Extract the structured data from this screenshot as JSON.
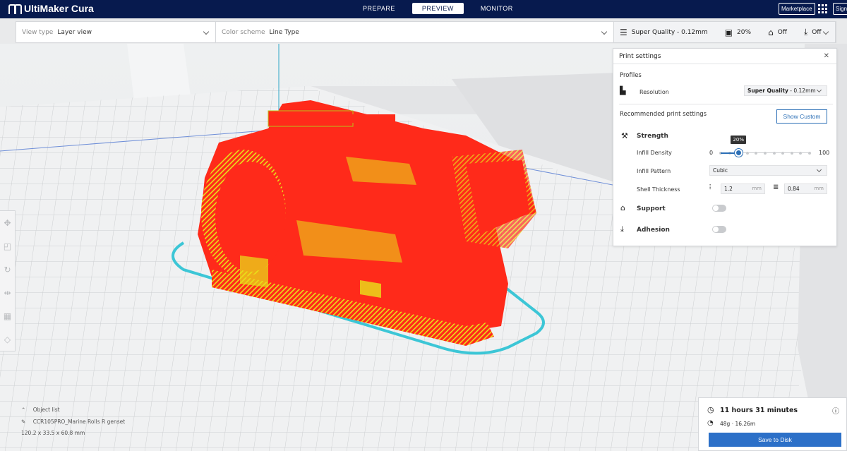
{
  "app": {
    "title": "UltiMaker Cura"
  },
  "stages": [
    {
      "label": "PREPARE",
      "active": false
    },
    {
      "label": "PREVIEW",
      "active": true
    },
    {
      "label": "MONITOR",
      "active": false
    }
  ],
  "header": {
    "marketplace_label": "Marketplace",
    "signin_label": "Sign"
  },
  "toolbar": {
    "view_type_label": "View type",
    "view_type_value": "Layer view",
    "color_scheme_label": "Color scheme",
    "color_scheme_value": "Line Type",
    "quality": "Super Quality - 0.12mm",
    "infill": "20%",
    "support": "Off",
    "adhesion": "Off"
  },
  "print_settings": {
    "title": "Print settings",
    "profiles_label": "Profiles",
    "resolution_label": "Resolution",
    "resolution_value_bold": "Super Quality",
    "resolution_value_rest": " - 0.12mm",
    "recommended_label": "Recommended print settings",
    "show_custom_label": "Show Custom",
    "strength_label": "Strength",
    "infill_density_label": "Infill Density",
    "infill_min": "0",
    "infill_max": "100",
    "infill_value": 20,
    "infill_tooltip": "20%",
    "infill_pattern_label": "Infill Pattern",
    "infill_pattern_value": "Cubic",
    "shell_thickness_label": "Shell Thickness",
    "wall_value": "1.2",
    "top_bottom_value": "0.84",
    "unit": "mm",
    "support_label": "Support",
    "adhesion_label": "Adhesion"
  },
  "object_list": {
    "label": "Object list",
    "object_name": "CCR105PRO_Marine Rolls R genset",
    "dimensions": "120.2 x 33.5 x 60.8 mm"
  },
  "estimate": {
    "time": "11 hours 31 minutes",
    "material": "48g · 16.26m",
    "save_label": "Save to Disk"
  },
  "colors": {
    "header_bg": "#071a4e",
    "accent": "#2c70c8",
    "model_red": "#ff2a1a",
    "model_infill": "#e8e21a",
    "skirt": "#3cc6d6"
  }
}
